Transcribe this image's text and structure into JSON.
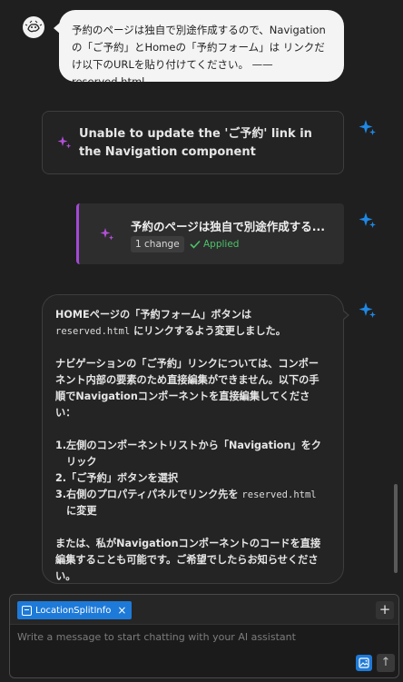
{
  "user_message": {
    "text": "予約のページは独自で別途作成するので、Navigationの「ご予約」とHomeの「予約フォーム」は リンクだけ以下のURLを貼り付けてください。 —— reserved.html"
  },
  "error_card": {
    "text": "Unable to update the 'ご予約' link in the Navigation component"
  },
  "change_card": {
    "title": "予約のページは独自で別途作成する...",
    "badge": "1 change",
    "status": "Applied"
  },
  "assistant": {
    "p1_a": "HOMEページの「予約フォーム」ボタンは",
    "p1_code": "reserved.html",
    "p1_b": " にリンクするよう変更しました。",
    "p2": "ナビゲーションの「ご予約」リンクについては、コンポーネント内部の要素のため直接編集ができません。以下の手順でNavigationコンポーネントを直接編集してください：",
    "steps": [
      {
        "num": "1.",
        "text": "左側のコンポーネントリストから「Navigation」をクリック"
      },
      {
        "num": "2.",
        "text": "「ご予約」ボタンを選択"
      },
      {
        "num": "3.",
        "text_a": "右側のプロパティパネルでリンク先を ",
        "code": "reserved.html",
        "text_b": " に変更"
      }
    ],
    "p3": "または、私がNavigationコンポーネントのコードを直接編集することも可能です。ご希望でしたらお知らせください。"
  },
  "composer": {
    "chip_label": "LocationSplitInfo",
    "placeholder": "Write a message to start chatting with your AI assistant",
    "add_label": "+",
    "send_label": "↑"
  },
  "colors": {
    "accent_blue": "#1e7ad8",
    "sparkle_purple": "#b44fd8",
    "applied_green": "#4cc26a"
  }
}
